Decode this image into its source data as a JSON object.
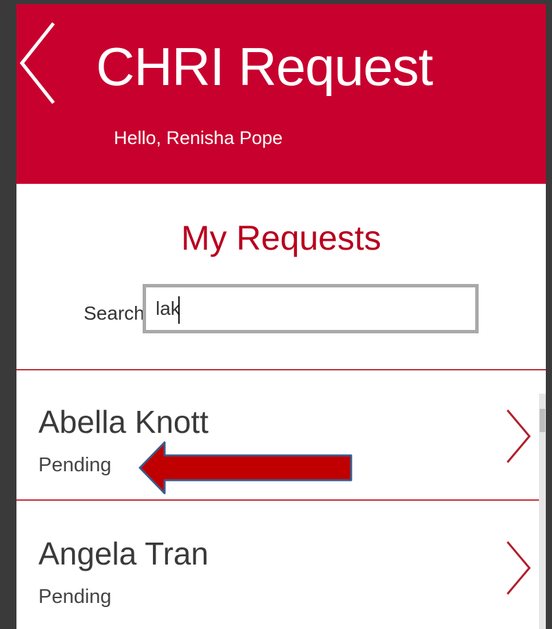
{
  "header": {
    "title": "CHRI Request",
    "greeting": "Hello, Renisha Pope",
    "color": "#c8002e"
  },
  "main": {
    "section_title": "My Requests",
    "search": {
      "label": "Search",
      "value": "lak"
    }
  },
  "requests": [
    {
      "name": "Abella Knott",
      "status": "Pending"
    },
    {
      "name": "Angela Tran",
      "status": "Pending"
    }
  ],
  "icons": {
    "back": "chevron-left-icon",
    "open_item": "chevron-right-icon"
  },
  "annotation": {
    "type": "arrow",
    "points_to": "Pending",
    "color": "#c00000"
  }
}
